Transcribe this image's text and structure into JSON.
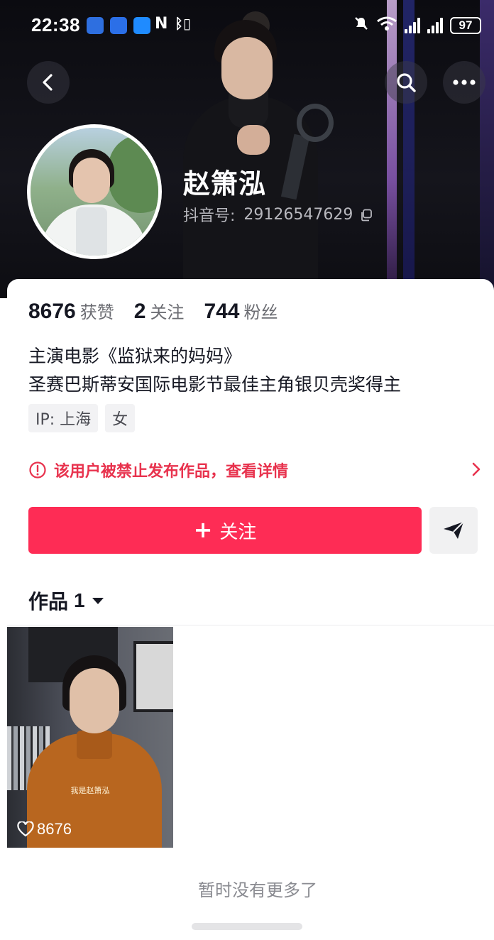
{
  "status_bar": {
    "time": "22:38",
    "battery": "97",
    "icons": [
      "app-icon",
      "app-icon",
      "app-icon",
      "nfc-icon",
      "bluetooth-icon",
      "mute-icon",
      "wifi-icon",
      "signal-icon",
      "signal-icon"
    ]
  },
  "profile": {
    "nickname": "赵箫泓",
    "douyin_id_label": "抖音号:",
    "douyin_id": "29126547629"
  },
  "stats": [
    {
      "value": "8676",
      "label": "获赞"
    },
    {
      "value": "2",
      "label": "关注"
    },
    {
      "value": "744",
      "label": "粉丝"
    }
  ],
  "bio": {
    "line1": "主演电影《监狱来的妈妈》",
    "line2": "圣赛巴斯蒂安国际电影节最佳主角银贝壳奖得主"
  },
  "tags": [
    "IP: 上海",
    "女"
  ],
  "warning": {
    "text": "该用户被禁止发布作品，查看详情",
    "color": "#e8334e"
  },
  "actions": {
    "follow_label": "关注",
    "follow_color": "#fe2c55"
  },
  "works": {
    "tab_label": "作品",
    "count": "1",
    "items": [
      {
        "likes": "8676",
        "caption": "我是赵箫泓"
      }
    ]
  },
  "footer": {
    "no_more_text": "暂时没有更多了"
  }
}
